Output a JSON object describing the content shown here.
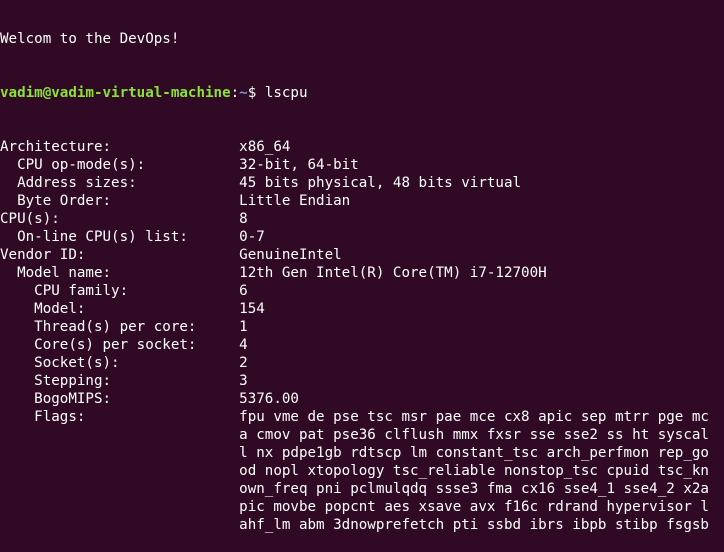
{
  "welcome": "Welcom to the DevOps!",
  "prompt": {
    "user_host": "vadim@vadim-virtual-machine",
    "sep": ":",
    "path": "~",
    "symbol": "$ ",
    "command": "lscpu"
  },
  "rows": [
    {
      "label": "Architecture:",
      "value": "x86_64"
    },
    {
      "label": "  CPU op-mode(s):",
      "value": "32-bit, 64-bit"
    },
    {
      "label": "  Address sizes:",
      "value": "45 bits physical, 48 bits virtual"
    },
    {
      "label": "  Byte Order:",
      "value": "Little Endian"
    },
    {
      "label": "CPU(s):",
      "value": "8"
    },
    {
      "label": "  On-line CPU(s) list:",
      "value": "0-7"
    },
    {
      "label": "Vendor ID:",
      "value": "GenuineIntel"
    },
    {
      "label": "  Model name:",
      "value": "12th Gen Intel(R) Core(TM) i7-12700H"
    },
    {
      "label": "    CPU family:",
      "value": "6"
    },
    {
      "label": "    Model:",
      "value": "154"
    },
    {
      "label": "    Thread(s) per core:",
      "value": "1"
    },
    {
      "label": "    Core(s) per socket:",
      "value": "4"
    },
    {
      "label": "    Socket(s):",
      "value": "2"
    },
    {
      "label": "    Stepping:",
      "value": "3"
    },
    {
      "label": "    BogoMIPS:",
      "value": "5376.00"
    },
    {
      "label": "    Flags:",
      "value": "fpu vme de pse tsc msr pae mce cx8 apic sep mtrr pge mc"
    }
  ],
  "flags_continuation": [
    "a cmov pat pse36 clflush mmx fxsr sse sse2 ss ht syscal",
    "l nx pdpe1gb rdtscp lm constant_tsc arch_perfmon rep_go",
    "od nopl xtopology tsc_reliable nonstop_tsc cpuid tsc_kn",
    "own_freq pni pclmulqdq ssse3 fma cx16 sse4_1 sse4_2 x2a",
    "pic movbe popcnt aes xsave avx f16c rdrand hypervisor l",
    "ahf_lm abm 3dnowprefetch pti ssbd ibrs ibpb stibp fsgsb"
  ]
}
